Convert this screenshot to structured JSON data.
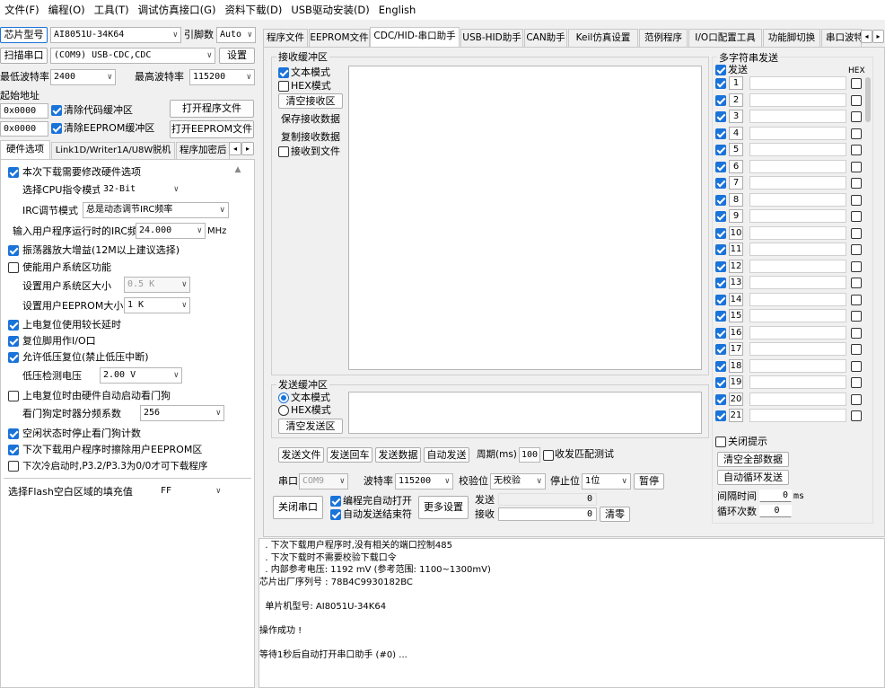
{
  "menu": [
    "文件(F)",
    "编程(O)",
    "工具(T)",
    "调试仿真接口(G)",
    "资料下载(D)",
    "USB驱动安装(D)",
    "English"
  ],
  "left": {
    "chip_btn": "芯片型号",
    "chip_value": "AI8051U-34K64",
    "pin_label": "引脚数",
    "pin_value": "Auto",
    "scan_btn": "扫描串口",
    "port_value": "(COM9) USB-CDC,CDC",
    "settings_btn": "设置",
    "min_baud_label": "最低波特率",
    "min_baud": "2400",
    "max_baud_label": "最高波特率",
    "max_baud": "115200",
    "start_addr_label": "起始地址",
    "addr1": "0x0000",
    "clear_code_label": "清除代码缓冲区",
    "open_prog_btn": "打开程序文件",
    "addr2": "0x0000",
    "clear_eeprom_label": "清除EEPROM缓冲区",
    "open_eeprom_btn": "打开EEPROM文件",
    "subtabs": [
      "硬件选项",
      "Link1D/Writer1A/U8W脱机",
      "程序加密后"
    ]
  },
  "hw": {
    "modify_hw": "本次下载需要修改硬件选项",
    "cpu_mode_label": "选择CPU指令模式",
    "cpu_mode": "32-Bit",
    "irc_mode_label": "IRC调节模式",
    "irc_mode": "总是动态调节IRC频率",
    "irc_freq_label": "输入用户程序运行时的IRC频率",
    "irc_freq": "24.000",
    "irc_unit": "MHz",
    "osc_gain": "振荡器放大增益(12M以上建议选择)",
    "sys_area": "使能用户系统区功能",
    "sys_size_label": "设置用户系统区大小",
    "sys_size": "0.5 K",
    "eeprom_size_label": "设置用户EEPROM大小",
    "eeprom_size": "1  K",
    "long_reset": "上电复位使用较长延时",
    "reset_io": "复位脚用作I/O口",
    "low_volt": "允许低压复位(禁止低压中断)",
    "low_volt_label": "低压检测电压",
    "low_volt_value": "2.00 V",
    "wdt_auto": "上电复位时由硬件自动启动看门狗",
    "wdt_div_label": "看门狗定时器分频系数",
    "wdt_div": "256",
    "idle_wdt": "空闲状态时停止看门狗计数",
    "erase_eeprom": "下次下载用户程序时擦除用户EEPROM区",
    "p32p33": "下次冷启动时,P3.2/P3.3为0/0才可下载程序",
    "fill_label": "选择Flash空白区域的填充值",
    "fill_value": "FF"
  },
  "tabs": [
    "程序文件",
    "EEPROM文件",
    "CDC/HID-串口助手",
    "USB-HID助手",
    "CAN助手",
    "Keil仿真设置",
    "范例程序",
    "I/O口配置工具",
    "功能脚切换",
    "串口波特"
  ],
  "rx": {
    "title": "接收缓冲区",
    "text_mode": "文本模式",
    "hex_mode": "HEX模式",
    "clear_btn": "清空接收区",
    "save_btn": "保存接收数据",
    "copy_btn": "复制接收数据",
    "to_file": "接收到文件"
  },
  "tx": {
    "title": "发送缓冲区",
    "text_mode": "文本模式",
    "hex_mode": "HEX模式",
    "clear_btn": "清空发送区",
    "send_file_btn": "发送文件",
    "send_enter_btn": "发送回车",
    "send_data_btn": "发送数据",
    "auto_send_btn": "自动发送",
    "period_label": "周期(ms)",
    "period": "100",
    "match_test": "收发匹配测试"
  },
  "port": {
    "port_label": "串口",
    "port_value": "COM9",
    "baud_label": "波特率",
    "baud_value": "115200",
    "parity_label": "校验位",
    "parity_value": "无校验",
    "stop_label": "停止位",
    "stop_value": "1位",
    "pause_btn": "暂停",
    "close_btn": "关闭串口",
    "auto_open": "编程完自动打开",
    "auto_end": "自动发送结束符",
    "more_btn": "更多设置",
    "send_label": "发送",
    "send_count": "0",
    "recv_label": "接收",
    "recv_count": "0",
    "clear_btn": "清零"
  },
  "multi": {
    "title": "多字符串发送",
    "send_label": "发送",
    "hex_label": "HEX",
    "rows": [
      "1",
      "2",
      "3",
      "4",
      "5",
      "6",
      "7",
      "8",
      "9",
      "10",
      "11",
      "12",
      "13",
      "14",
      "15",
      "16",
      "17",
      "18",
      "19",
      "20",
      "21"
    ],
    "close_tip": "关闭提示",
    "clear_all_btn": "清空全部数据",
    "auto_loop_btn": "自动循环发送",
    "interval_label": "间隔时间",
    "interval": "0",
    "interval_unit": "ms",
    "loop_label": "循环次数",
    "loop_value": "0"
  },
  "log": [
    "  . 下次下载用户程序时,没有相关的端口控制485",
    "  . 下次下载时不需要校验下载口令",
    "  . 内部参考电压: 1192 mV (参考范围: 1100~1300mV)",
    "芯片出厂序列号 : 78B4C9930182BC",
    "",
    "  单片机型号: AI8051U-34K64",
    "",
    "操作成功 !",
    "",
    "等待1秒后自动打开串口助手 (#0) ..."
  ]
}
